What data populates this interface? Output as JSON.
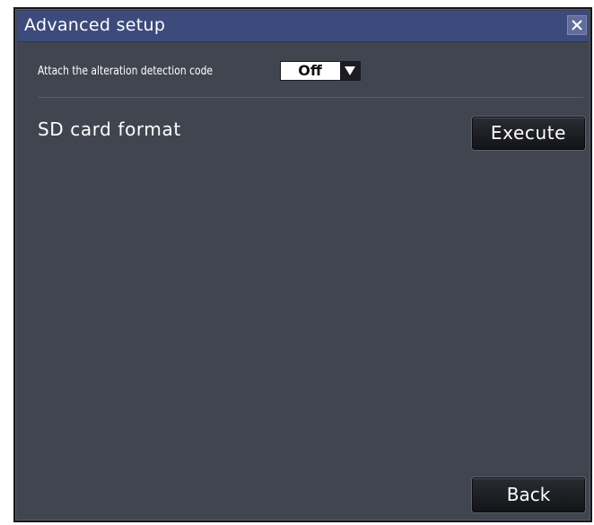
{
  "dialog": {
    "title": "Advanced setup",
    "close_icon": "close-icon"
  },
  "alteration_detection": {
    "label": "Attach the alteration detection code",
    "selected_value": "Off",
    "arrow_icon": "dropdown-arrow-icon"
  },
  "sd_card": {
    "label": "SD card format",
    "execute_label": "Execute"
  },
  "footer": {
    "back_label": "Back"
  },
  "colors": {
    "titlebar": "#3c4a7c",
    "panel": "#414550",
    "button": "#1b1d22"
  }
}
